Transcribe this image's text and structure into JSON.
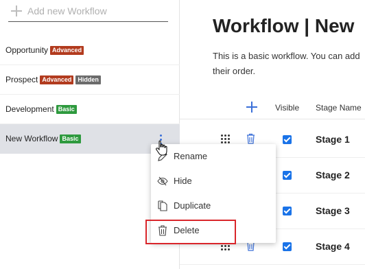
{
  "sidebar": {
    "add_placeholder": "Add new Workflow",
    "workflows": [
      {
        "name": "Opportunity",
        "badges": [
          {
            "text": "Advanced",
            "kind": "advanced"
          }
        ]
      },
      {
        "name": "Prospect",
        "badges": [
          {
            "text": "Advanced",
            "kind": "advanced"
          },
          {
            "text": "Hidden",
            "kind": "hidden"
          }
        ]
      },
      {
        "name": "Development",
        "badges": [
          {
            "text": "Basic",
            "kind": "basic"
          }
        ]
      },
      {
        "name": "New Workflow",
        "badges": [
          {
            "text": "Basic",
            "kind": "basic"
          }
        ],
        "selected": true
      }
    ]
  },
  "main": {
    "title": "Workflow | New",
    "description_line1": "This is a basic workflow. You can add",
    "description_line2": "their order.",
    "table": {
      "headers": {
        "visible": "Visible",
        "stage_name": "Stage Name"
      },
      "rows": [
        {
          "stage": "Stage 1",
          "visible": true
        },
        {
          "stage": "Stage 2",
          "visible": true
        },
        {
          "stage": "Stage 3",
          "visible": true
        },
        {
          "stage": "Stage 4",
          "visible": true
        }
      ]
    }
  },
  "context_menu": {
    "items": [
      {
        "label": "Rename",
        "icon": "pencil-icon"
      },
      {
        "label": "Hide",
        "icon": "eye-slash-icon"
      },
      {
        "label": "Duplicate",
        "icon": "copy-icon"
      },
      {
        "label": "Delete",
        "icon": "trash-icon",
        "highlighted": true
      }
    ]
  },
  "colors": {
    "accent": "#3a6fd8",
    "checkbox": "#1a73e8",
    "badge_advanced": "#b23b1e",
    "badge_hidden": "#6b6b6b",
    "badge_basic": "#2e9a3e",
    "highlight_border": "#d9252a",
    "selected_row": "#dfe1e6"
  }
}
